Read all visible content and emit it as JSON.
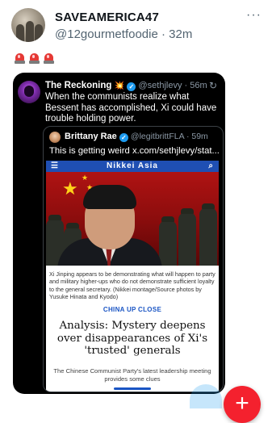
{
  "post": {
    "author_name": "SAVEAMERICA47",
    "handle": "@12gourmetfoodie",
    "time": "32m",
    "more": "···",
    "emoji_count": 3
  },
  "quoted": {
    "name": "The Reckoning",
    "badge": "💥",
    "verified": "✓",
    "handle": "@sethjlevy",
    "time": "56m",
    "refresh": "↻",
    "text": "When the communists realize what Bessent has accomplished, Xi could have trouble holding power."
  },
  "inner_quote": {
    "name": "Brittany Rae",
    "verified": "✓",
    "handle": "@legitbrittFLA",
    "time": "59m",
    "text": "This is getting weird x.com/sethjlevy/stat..."
  },
  "article": {
    "masthead": "Nikkei Asia",
    "caption": "Xi Jinping appears to be demonstrating what will happen to party and military higher-ups who do not demonstrate sufficient loyalty to the general secretary. (Nikkei montage/Source photos by Yusuke Hinata and Kyodo)",
    "kicker": "CHINA UP CLOSE",
    "headline": "Analysis: Mystery deepens over disappearances of Xi's 'trusted' generals",
    "deck": "The Chinese Communist Party's latest leadership meeting provides some clues"
  },
  "fab": {
    "label": "+"
  },
  "colors": {
    "verified_blue": "#1d9bf0",
    "fab_red": "#f4212e",
    "kicker_blue": "#1a55c4"
  }
}
